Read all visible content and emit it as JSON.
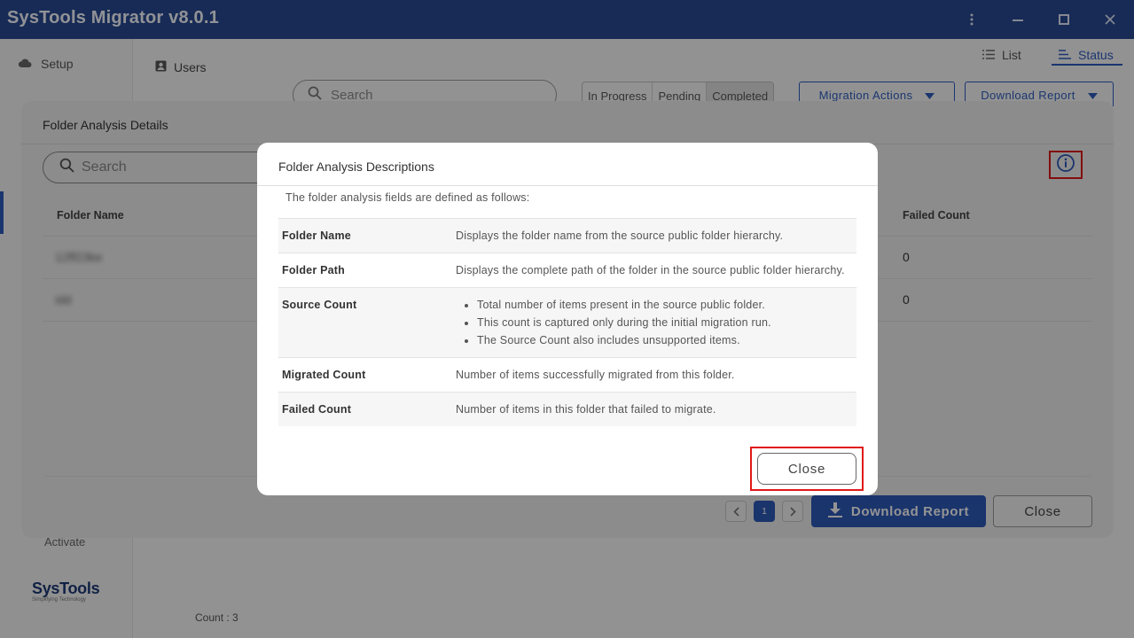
{
  "app": {
    "title": "SysTools Migrator v8.0.1"
  },
  "sidebar": {
    "setup_label": "Setup",
    "activate_label": "Activate",
    "logo_name": "SysTools",
    "logo_tagline": "Simplifying Technology"
  },
  "main": {
    "users_label": "Users",
    "view_list": "List",
    "view_status": "Status",
    "search_placeholder": "Search",
    "filters": [
      "In Progress",
      "Pending",
      "Completed"
    ],
    "migration_actions": "Migration Actions",
    "download_report": "Download Report",
    "count_label": "Count : 3"
  },
  "folder_details": {
    "title": "Folder Analysis Details",
    "search_placeholder": "Search",
    "columns": {
      "folder_name": "Folder Name",
      "failed_count": "Failed Count"
    },
    "rows": [
      {
        "folder_name": "12ff23ke",
        "failed_count": "0"
      },
      {
        "folder_name": "idd",
        "failed_count": "0"
      }
    ],
    "page": "1",
    "download_label": "Download Report",
    "close_label": "Close"
  },
  "descriptions": {
    "title": "Folder Analysis Descriptions",
    "intro": "The folder analysis fields are defined as follows:",
    "fields": {
      "folder_name": {
        "term": "Folder Name",
        "desc": "Displays the folder name from the source public folder hierarchy."
      },
      "folder_path": {
        "term": "Folder Path",
        "desc": "Displays the complete path of the folder in the source public folder hierarchy."
      },
      "source_count": {
        "term": "Source Count",
        "bullets": [
          "Total number of items present in the source public folder.",
          "This count is captured only during the initial migration run.",
          "The Source Count also includes unsupported items."
        ]
      },
      "migrated_count": {
        "term": "Migrated Count",
        "desc": "Number of items successfully migrated from this folder."
      },
      "failed_count": {
        "term": "Failed Count",
        "desc": "Number of items in this folder that failed to migrate."
      }
    },
    "close_label": "Close"
  },
  "colors": {
    "titlebar": "#27488f",
    "accent": "#2e5bba",
    "highlight": "#e01818"
  }
}
